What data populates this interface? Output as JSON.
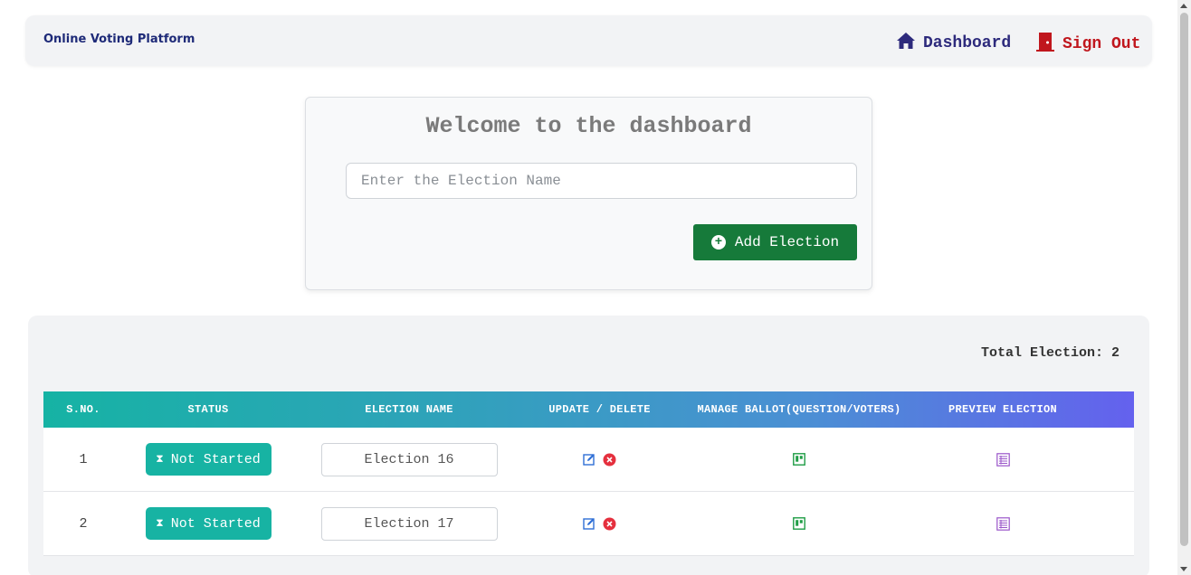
{
  "navbar": {
    "brand": "Online Voting Platform",
    "dashboard_label": "Dashboard",
    "signout_label": "Sign Out",
    "dashboard_icon": "home-icon",
    "signout_icon": "door-icon",
    "dashboard_color": "#2d2a7c",
    "signout_color": "#c0161d"
  },
  "welcome": {
    "title": "Welcome to the dashboard",
    "input_placeholder": "Enter the Election Name",
    "input_value": "",
    "add_button_label": "Add Election",
    "add_button_icon": "plus-circle-icon",
    "add_button_color": "#167a3a"
  },
  "elections": {
    "total_label": "Total Election: 2",
    "columns": [
      "S.NO.",
      "STATUS",
      "ELECTION NAME",
      "UPDATE / DELETE",
      "MANAGE BALLOT(QUESTION/VOTERS)",
      "PREVIEW ELECTION"
    ],
    "rows": [
      {
        "sno": "1",
        "status": "Not Started",
        "name": "Election 16"
      },
      {
        "sno": "2",
        "status": "Not Started",
        "name": "Election 17"
      }
    ],
    "status_color": "#17b3a3",
    "icons": {
      "status": "hourglass-icon",
      "edit": "edit-icon",
      "delete": "delete-icon",
      "manage": "ballot-icon",
      "preview": "preview-icon"
    }
  }
}
